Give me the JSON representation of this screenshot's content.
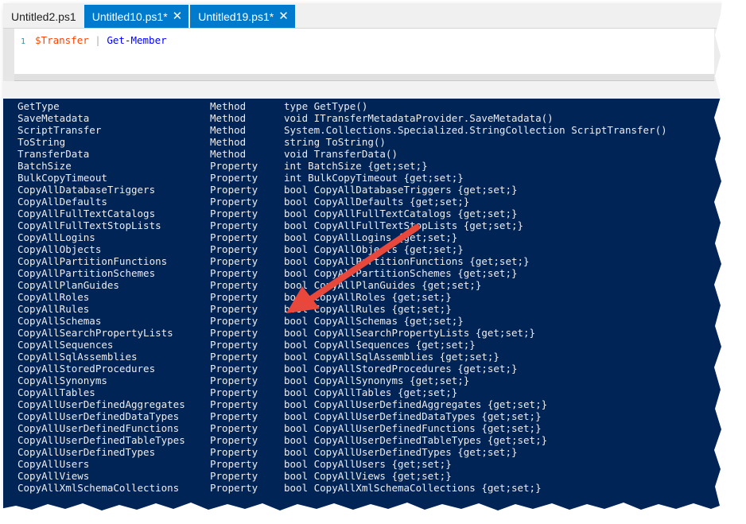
{
  "tabs": [
    {
      "label": "Untitled2.ps1",
      "active": false,
      "closable": false
    },
    {
      "label": "Untitled10.ps1*",
      "active": true,
      "closable": true
    },
    {
      "label": "Untitled19.ps1*",
      "active": true,
      "closable": true
    }
  ],
  "editor": {
    "line_number": "1",
    "variable": "$Transfer",
    "pipe": "|",
    "command": "Get-Member"
  },
  "members": [
    {
      "name": "GetType",
      "type": "Method",
      "definition": "type GetType()"
    },
    {
      "name": "SaveMetadata",
      "type": "Method",
      "definition": "void ITransferMetadataProvider.SaveMetadata()"
    },
    {
      "name": "ScriptTransfer",
      "type": "Method",
      "definition": "System.Collections.Specialized.StringCollection ScriptTransfer()"
    },
    {
      "name": "ToString",
      "type": "Method",
      "definition": "string ToString()"
    },
    {
      "name": "TransferData",
      "type": "Method",
      "definition": "void TransferData()"
    },
    {
      "name": "BatchSize",
      "type": "Property",
      "definition": "int BatchSize {get;set;}"
    },
    {
      "name": "BulkCopyTimeout",
      "type": "Property",
      "definition": "int BulkCopyTimeout {get;set;}"
    },
    {
      "name": "CopyAllDatabaseTriggers",
      "type": "Property",
      "definition": "bool CopyAllDatabaseTriggers {get;set;}"
    },
    {
      "name": "CopyAllDefaults",
      "type": "Property",
      "definition": "bool CopyAllDefaults {get;set;}"
    },
    {
      "name": "CopyAllFullTextCatalogs",
      "type": "Property",
      "definition": "bool CopyAllFullTextCatalogs {get;set;}"
    },
    {
      "name": "CopyAllFullTextStopLists",
      "type": "Property",
      "definition": "bool CopyAllFullTextStopLists {get;set;}"
    },
    {
      "name": "CopyAllLogins",
      "type": "Property",
      "definition": "bool CopyAllLogins {get;set;}"
    },
    {
      "name": "CopyAllObjects",
      "type": "Property",
      "definition": "bool CopyAllObjects {get;set;}"
    },
    {
      "name": "CopyAllPartitionFunctions",
      "type": "Property",
      "definition": "bool CopyAllPartitionFunctions {get;set;}"
    },
    {
      "name": "CopyAllPartitionSchemes",
      "type": "Property",
      "definition": "bool CopyAllPartitionSchemes {get;set;}"
    },
    {
      "name": "CopyAllPlanGuides",
      "type": "Property",
      "definition": "bool CopyAllPlanGuides {get;set;}"
    },
    {
      "name": "CopyAllRoles",
      "type": "Property",
      "definition": "bool CopyAllRoles {get;set;}"
    },
    {
      "name": "CopyAllRules",
      "type": "Property",
      "definition": "bool CopyAllRules {get;set;}"
    },
    {
      "name": "CopyAllSchemas",
      "type": "Property",
      "definition": "bool CopyAllSchemas {get;set;}"
    },
    {
      "name": "CopyAllSearchPropertyLists",
      "type": "Property",
      "definition": "bool CopyAllSearchPropertyLists {get;set;}"
    },
    {
      "name": "CopyAllSequences",
      "type": "Property",
      "definition": "bool CopyAllSequences {get;set;}"
    },
    {
      "name": "CopyAllSqlAssemblies",
      "type": "Property",
      "definition": "bool CopyAllSqlAssemblies {get;set;}"
    },
    {
      "name": "CopyAllStoredProcedures",
      "type": "Property",
      "definition": "bool CopyAllStoredProcedures {get;set;}"
    },
    {
      "name": "CopyAllSynonyms",
      "type": "Property",
      "definition": "bool CopyAllSynonyms {get;set;}"
    },
    {
      "name": "CopyAllTables",
      "type": "Property",
      "definition": "bool CopyAllTables {get;set;}"
    },
    {
      "name": "CopyAllUserDefinedAggregates",
      "type": "Property",
      "definition": "bool CopyAllUserDefinedAggregates {get;set;}"
    },
    {
      "name": "CopyAllUserDefinedDataTypes",
      "type": "Property",
      "definition": "bool CopyAllUserDefinedDataTypes {get;set;}"
    },
    {
      "name": "CopyAllUserDefinedFunctions",
      "type": "Property",
      "definition": "bool CopyAllUserDefinedFunctions {get;set;}"
    },
    {
      "name": "CopyAllUserDefinedTableTypes",
      "type": "Property",
      "definition": "bool CopyAllUserDefinedTableTypes {get;set;}"
    },
    {
      "name": "CopyAllUserDefinedTypes",
      "type": "Property",
      "definition": "bool CopyAllUserDefinedTypes {get;set;}"
    },
    {
      "name": "CopyAllUsers",
      "type": "Property",
      "definition": "bool CopyAllUsers {get;set;}"
    },
    {
      "name": "CopyAllViews",
      "type": "Property",
      "definition": "bool CopyAllViews {get;set;}"
    },
    {
      "name": "CopyAllXmlSchemaCollections",
      "type": "Property",
      "definition": "bool CopyAllXmlSchemaCollections {get;set;}"
    }
  ],
  "colors": {
    "console_bg": "#012456",
    "console_text": "#eeedf0",
    "tab_active": "#007acc",
    "annotation_arrow": "#e8473b"
  },
  "annotation": {
    "type": "arrow",
    "points_to": "CopyAllSchemas"
  }
}
